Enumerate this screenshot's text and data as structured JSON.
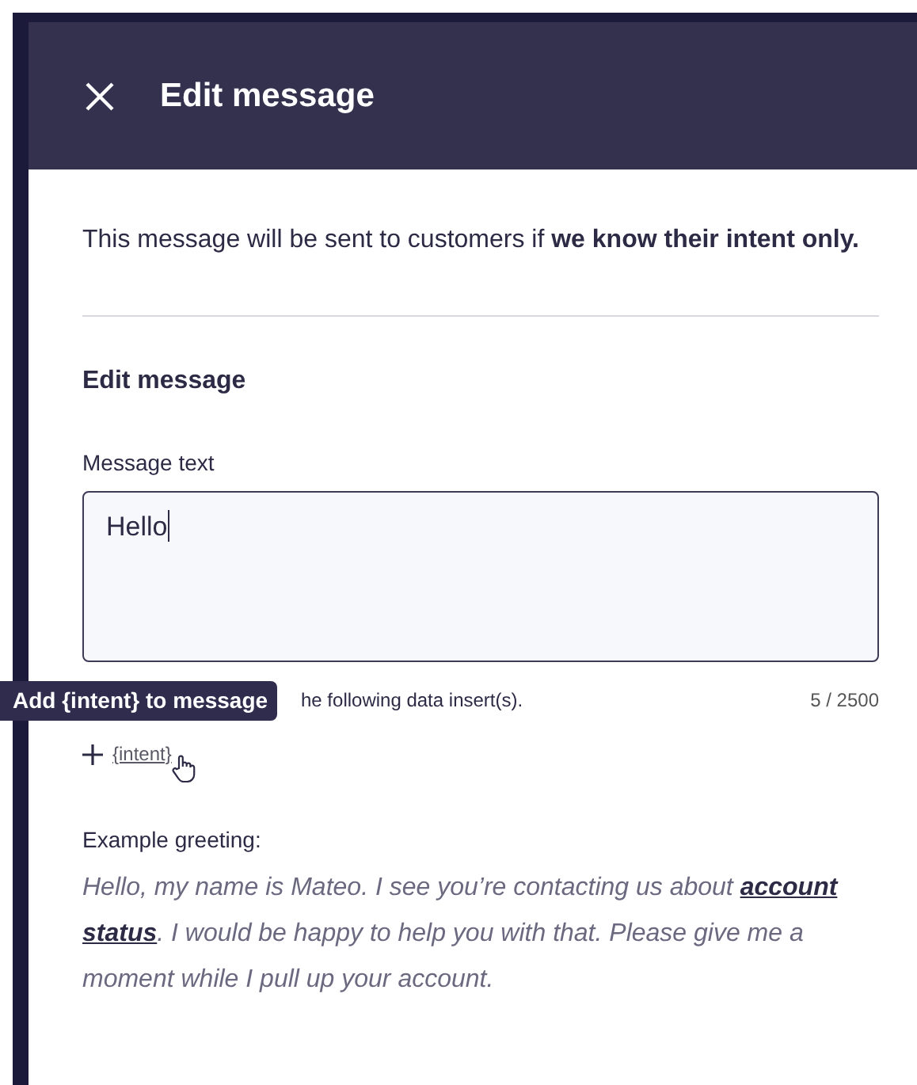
{
  "header": {
    "title": "Edit message"
  },
  "intro": "This message will be sent to customers if **we know their intent only.**",
  "section": {
    "heading": "Edit message"
  },
  "message_field": {
    "label": "Message text",
    "value": "Hello"
  },
  "tooltip": "Add {intent} to message",
  "helper_text": "he following data insert(s).",
  "counter": "5 / 2500",
  "insert": {
    "label": "{intent}"
  },
  "example": {
    "label": "Example greeting:",
    "text": "Hello, my name is Mateo. I see you’re contacting us about **account status**. I would be happy to help you with that. Please give me a moment while I pull up your account."
  }
}
